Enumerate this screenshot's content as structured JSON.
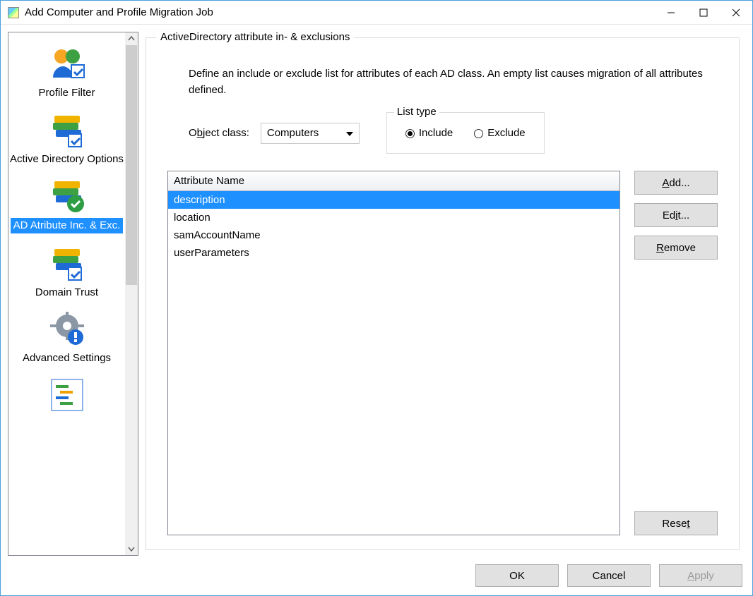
{
  "window": {
    "title": "Add Computer and Profile Migration Job"
  },
  "sidebar": {
    "items": [
      {
        "label": "Profile Filter"
      },
      {
        "label": "Active Directory Options"
      },
      {
        "label": "AD Atribute Inc. & Exc."
      },
      {
        "label": "Domain Trust"
      },
      {
        "label": "Advanced Settings"
      }
    ]
  },
  "group": {
    "legend": "ActiveDirectory attribute in- & exclusions",
    "instruction": "Define an include or exclude list for attributes of each AD class. An empty list causes migration of all attributes defined."
  },
  "object_class": {
    "label_pre": "O",
    "label_ul": "b",
    "label_post": "ject class:",
    "value": "Computers"
  },
  "list_type": {
    "legend": "List type",
    "include_pre": "",
    "include_ul": "I",
    "include_post": "nclude",
    "exclude_pre": "",
    "exclude_ul": "E",
    "exclude_post": "xclude",
    "selected": "include"
  },
  "attr_table": {
    "header": "Attribute Name",
    "rows": [
      {
        "name": "description",
        "selected": true
      },
      {
        "name": "location",
        "selected": false
      },
      {
        "name": "samAccountName",
        "selected": false
      },
      {
        "name": "userParameters",
        "selected": false
      }
    ]
  },
  "buttons": {
    "add_ul": "A",
    "add_post": "dd...",
    "edit_pre": "Ed",
    "edit_ul": "i",
    "edit_post": "t...",
    "remove_ul": "R",
    "remove_post": "emove",
    "reset_pre": "Rese",
    "reset_ul": "t"
  },
  "footer": {
    "ok": "OK",
    "cancel": "Cancel",
    "apply_ul": "A",
    "apply_post": "pply"
  }
}
